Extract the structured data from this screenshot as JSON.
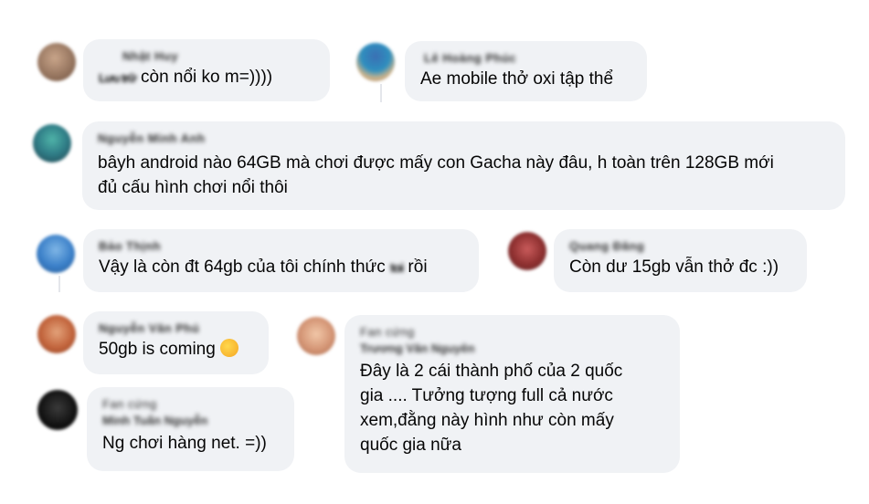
{
  "comments": [
    {
      "id": "c1",
      "name": "Nhật Huy",
      "prefix": "Lưu trữ",
      "text": " còn nổi ko m=))))"
    },
    {
      "id": "c2",
      "name": "Lê Hoàng Phúc",
      "text": "Ae mobile thở oxi tập thể"
    },
    {
      "id": "c3",
      "name": "Nguyễn Minh Anh",
      "text_line1": "bâyh android nào 64GB mà chơi được mấy con Gacha này đâu, h toàn trên 128GB mới",
      "text_line2": "đủ cấu hình chơi nổi thôi"
    },
    {
      "id": "c4",
      "name": "Bảo Thịnh",
      "text_pre": "Vậy là còn đt 64gb của tôi chính thức ",
      "hidden": "toi",
      "text_post": " rồi"
    },
    {
      "id": "c5",
      "name": "Quang Đăng",
      "text": "Còn dư 15gb vẫn thở đc :))"
    },
    {
      "id": "c6",
      "name": "Nguyễn Văn Phú",
      "text": "50gb is coming "
    },
    {
      "id": "c7",
      "badge": "Fan cứng",
      "name": "Trương Văn Nguyên",
      "lines": [
        "Đây là 2 cái thành phố của 2 quốc",
        "gia .... Tưởng tượng full cả nước",
        "xem,đằng này hình như còn mấy",
        "quốc gia nữa"
      ]
    },
    {
      "id": "c8",
      "badge": "Fan cứng",
      "name": "Minh Tuấn Nguyễn",
      "text": "Ng chơi hàng net. =))"
    }
  ]
}
